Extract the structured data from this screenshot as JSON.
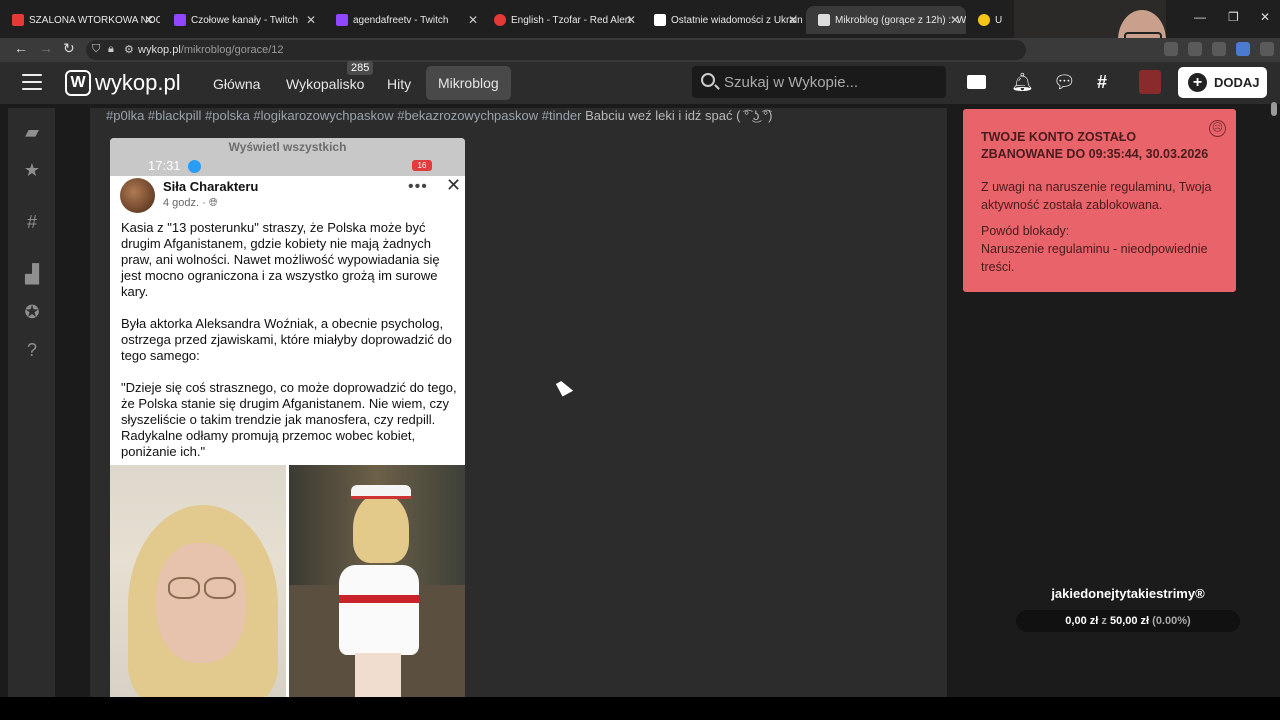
{
  "browser": {
    "tabs": [
      {
        "title": "SZALONA WTORKOWA NOC",
        "favicon_color": "#e53935"
      },
      {
        "title": "Czołowe kanały - Twitch",
        "favicon_color": "#9146ff"
      },
      {
        "title": "agendafreetv - Twitch",
        "favicon_color": "#9146ff"
      },
      {
        "title": "English - Tzofar - Red Alert",
        "favicon_color": "#e53935"
      },
      {
        "title": "Ostatnie wiadomości z Ukrain",
        "favicon_color": "#ffffff"
      },
      {
        "title": "Mikroblog (gorące z 12h) :: W",
        "favicon_color": "#dddddd"
      },
      {
        "title": "U",
        "favicon_color": "#f5c518"
      }
    ],
    "url_host": "wykop.pl",
    "url_path": "/mikroblog/gorace/12"
  },
  "site": {
    "logo_text": "wykop.pl",
    "nav": [
      {
        "label": "Główna"
      },
      {
        "label": "Wykopalisko",
        "badge": "285"
      },
      {
        "label": "Hity"
      },
      {
        "label": "Mikroblog",
        "active": true
      }
    ],
    "search_placeholder": "Szukaj w Wykopie...",
    "add_button": "DODAJ"
  },
  "post": {
    "tags": "#p0lka #blackpill #polska #logikarozowychpaskow #bekazrozowychpaskow #tinder",
    "text": "Babciu weź leki i idź spać ( ͡° ͜ʖ ͡°)",
    "embed": {
      "show_all": "Wyświetl wszystkich",
      "phone_time": "17:31",
      "battery": "16",
      "author": "Siła Charakteru",
      "meta": "4 godz. · ",
      "paragraphs": [
        "Kasia z \"13 posterunku\" straszy, że Polska może być drugim Afganistanem, gdzie kobiety nie mają żadnych praw, ani wolności. Nawet możliwość wypowiadania się jest mocno ograniczona i za wszystko grożą im surowe kary.",
        "Była aktorka Aleksandra Woźniak, a obecnie psycholog, ostrzega przed zjawiskami, które miałyby doprowadzić do tego samego:",
        "\"Dzieje się coś strasznego, co może doprowadzić do tego, że Polska stanie się drugim Afganistanem. Nie wiem, czy słyszeliście o takim trendzie jak manosfera, czy redpill. Radykalne odłamy promują przemoc wobec kobiet, poniżanie ich.\""
      ]
    }
  },
  "ban_notice": {
    "title": "TWOJE KONTO ZOSTAŁO ZBANOWANE DO 09:35:44, 30.03.2026",
    "message": "Z uwagi na naruszenie regulaminu, Twoja aktywność została zablokowana.",
    "reason_label": "Powód blokady:",
    "reason": "Naruszenie regulaminu - nieodpowiednie treści."
  },
  "donation": {
    "title": "jakiedonejtytakiestrimy®",
    "current": "0,00 zł",
    "separator": "z",
    "goal": "50,00 zł",
    "percent": "(0.00%)",
    "progress": 0.0
  }
}
